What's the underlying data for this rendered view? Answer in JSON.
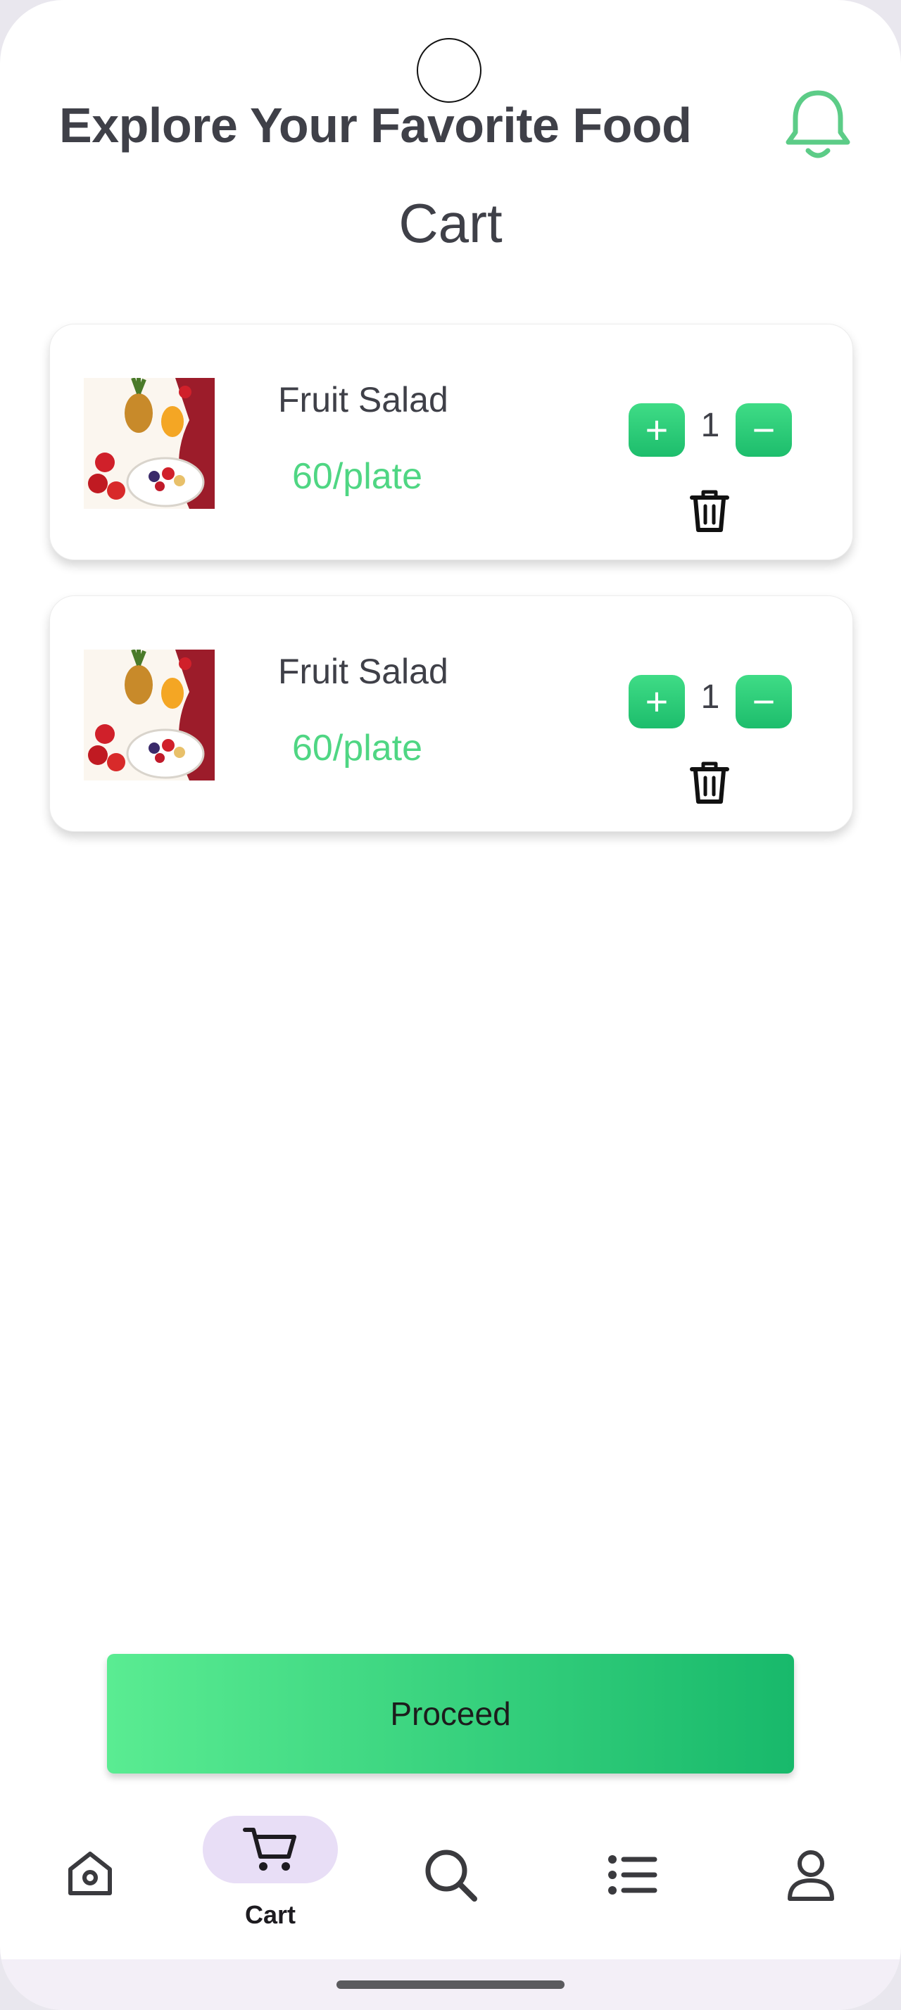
{
  "header": {
    "title": "Explore Your Favorite Food"
  },
  "page": {
    "title": "Cart"
  },
  "cart": {
    "items": [
      {
        "name": "Fruit Salad",
        "price": "60/plate",
        "quantity": "1"
      },
      {
        "name": "Fruit Salad",
        "price": "60/plate",
        "quantity": "1"
      }
    ]
  },
  "actions": {
    "proceed_label": "Proceed",
    "plus": "+",
    "minus": "−"
  },
  "nav": {
    "items": [
      {
        "icon": "home-icon"
      },
      {
        "icon": "cart-icon",
        "label": "Cart",
        "active": true
      },
      {
        "icon": "search-icon"
      },
      {
        "icon": "list-icon"
      },
      {
        "icon": "profile-icon"
      }
    ]
  },
  "colors": {
    "accent_green": "#1dbd6c",
    "price_green": "#4fd683",
    "text_dark": "#3f4048",
    "nav_active": "#e8def6"
  }
}
